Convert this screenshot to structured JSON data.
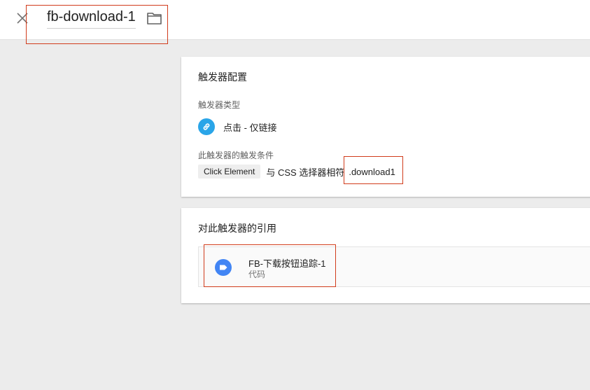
{
  "header": {
    "title": "fb-download-1",
    "close_icon": "close-icon",
    "folder_icon": "folder-icon"
  },
  "trigger_config": {
    "section_title": "触发器配置",
    "type_label": "触发器类型",
    "type_icon": "link-icon",
    "type_value": "点击 - 仅链接",
    "fires_on_label": "此触发器的触发条件",
    "condition": {
      "variable": "Click Element",
      "operator": "与 CSS 选择器相符",
      "value": ".download1"
    }
  },
  "references": {
    "section_title": "对此触发器的引用",
    "items": [
      {
        "name": "FB-下载按钮追踪-1",
        "type": "代码",
        "icon": "tag-icon"
      }
    ]
  },
  "colors": {
    "highlight": "#d13c1c",
    "link_icon_bg": "#2aa5e8",
    "tag_icon_bg": "#4285f4",
    "background": "#ececec"
  }
}
